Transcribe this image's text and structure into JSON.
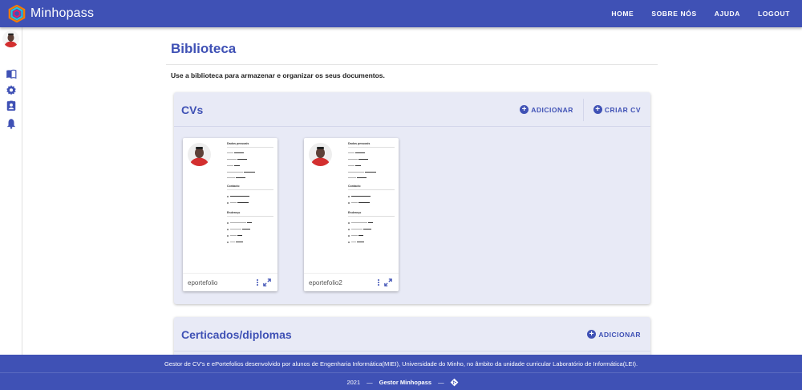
{
  "app": {
    "name": "Minhopass"
  },
  "nav": {
    "home": "HOME",
    "about": "SOBRE NÓS",
    "help": "AJUDA",
    "logout": "LOGOUT"
  },
  "page": {
    "title": "Biblioteca",
    "description": "Use a biblioteca para armazenar e organizar os seus documentos."
  },
  "cvs": {
    "title": "CVs",
    "add_label": "ADICIONAR",
    "create_label": "CRIAR CV",
    "items": [
      {
        "name": "eportefolio"
      },
      {
        "name": "eportefolio2"
      }
    ]
  },
  "certs": {
    "title": "Certicados/diplomas",
    "add_label": "ADICIONAR"
  },
  "footer": {
    "text": "Gestor de CV's e ePortefolios desenvolvido por alunos de Engenharia Informática(MIEI), Universidade do Minho, no âmbito da unidade curricular Laboratório de Informática(LEI).",
    "year": "2021",
    "dash": "—",
    "project": "Gestor Minhopass"
  },
  "sidebar": {
    "icons": [
      "book-icon",
      "gear-icon",
      "contact-card-icon",
      "bell-icon"
    ]
  },
  "colors": {
    "primary": "#3f51b5",
    "panel": "#e8eaf6",
    "avatar_shirt": "#d32f2f"
  }
}
